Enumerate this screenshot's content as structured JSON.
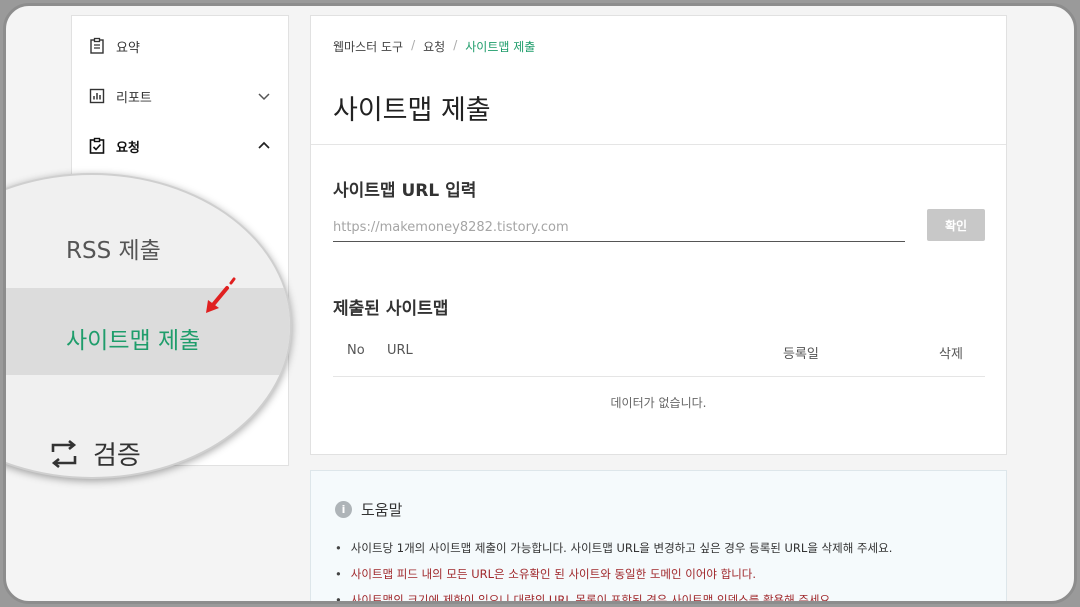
{
  "sidebar": {
    "items": [
      {
        "label": "요약",
        "icon": "clipboard-icon",
        "chevron": ""
      },
      {
        "label": "리포트",
        "icon": "chart-icon",
        "chevron": "down"
      },
      {
        "label": "요청",
        "icon": "checklist-icon",
        "chevron": "up"
      }
    ],
    "zoom": {
      "rss_label": "RSS 제출",
      "sitemap_label": "사이트맵 제출",
      "verify_label": "검증"
    }
  },
  "breadcrumb": {
    "items": [
      "웹마스터 도구",
      "요청"
    ],
    "current": "사이트맵 제출",
    "separator": "/"
  },
  "page_title": "사이트맵 제출",
  "sitemap_input": {
    "heading": "사이트맵 URL 입력",
    "placeholder": "https://makemoney8282.tistory.com",
    "button_label": "확인"
  },
  "submitted": {
    "heading": "제출된 사이트맵",
    "columns": {
      "no": "No",
      "url": "URL",
      "date": "등록일",
      "delete": "삭제"
    },
    "empty_message": "데이터가 없습니다."
  },
  "help": {
    "title": "도움말",
    "items": [
      {
        "text": "사이트당 1개의 사이트맵 제출이 가능합니다. 사이트맵 URL을 변경하고 싶은 경우 등록된 URL을 삭제해 주세요.",
        "highlight": false
      },
      {
        "text": "사이트맵 피드 내의 모든 URL은 소유확인 된 사이트와 동일한 도메인 이어야 합니다.",
        "highlight": true
      },
      {
        "text": "사이트맵의 크기에 제한이 있으니 대량의 URL 목록이 포함된 경우 사이트맵 인덱스를 활용해 주세요.",
        "highlight": true
      }
    ]
  },
  "colors": {
    "accent": "#1f9d6b",
    "warning": "#a0282c",
    "button_disabled": "#c8c8c8"
  }
}
